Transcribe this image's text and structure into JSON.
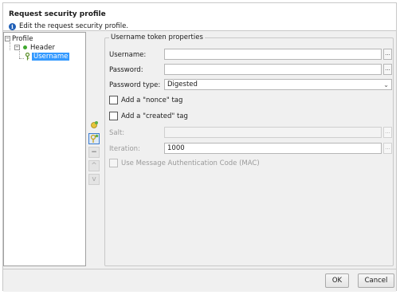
{
  "dialog": {
    "title": "Request security profile",
    "subtitle": "Edit the request security profile."
  },
  "tree": {
    "root_label": "Profile",
    "header_label": "Header",
    "username_label": "Username"
  },
  "properties": {
    "group_title": "Username token properties",
    "username_label": "Username:",
    "username_value": "",
    "password_label": "Password:",
    "password_value": "",
    "password_type_label": "Password type:",
    "password_type_value": "Digested",
    "nonce_label": "Add a \"nonce\" tag",
    "created_label": "Add a \"created\" tag",
    "salt_label": "Salt:",
    "salt_value": "",
    "iteration_label": "Iteration:",
    "iteration_value": "1000",
    "mac_label": "Use Message Authentication Code (MAC)",
    "browse_label": "..."
  },
  "footer": {
    "ok_label": "OK",
    "cancel_label": "Cancel"
  },
  "icons": {
    "info": "i",
    "collapse": "−",
    "remove": "−",
    "up": "^",
    "down": "v"
  }
}
